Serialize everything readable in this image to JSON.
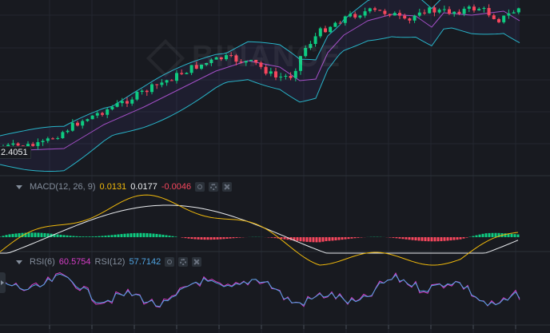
{
  "watermark": "BINANCE",
  "price_label": "2.4051",
  "macd": {
    "name": "MACD(12, 26, 9)",
    "dif": "0.0131",
    "dea": "0.0177",
    "hist": "-0.0046",
    "colors": {
      "dif": "#f0b90b",
      "dea": "#eaecef",
      "hist_up": "#0ecb81",
      "hist_down": "#f6465d"
    }
  },
  "rsi": {
    "name6": "RSI(6)",
    "value6": "60.5754",
    "name12": "RSI(12)",
    "value12": "57.7142",
    "colors": {
      "rsi6": "#d83ec8",
      "rsi12": "#4fa3e0"
    }
  },
  "theme": {
    "background": "#181a20",
    "candle_up": "#0ecb81",
    "candle_down": "#f6465d",
    "bollinger_band": "#28b4c8",
    "bollinger_mid": "#a34fc6",
    "grid": "#23272f"
  },
  "icons": [
    "collapse-caret-icon",
    "eye-icon",
    "gear-icon",
    "close-icon",
    "expand-arrow-icon"
  ]
}
